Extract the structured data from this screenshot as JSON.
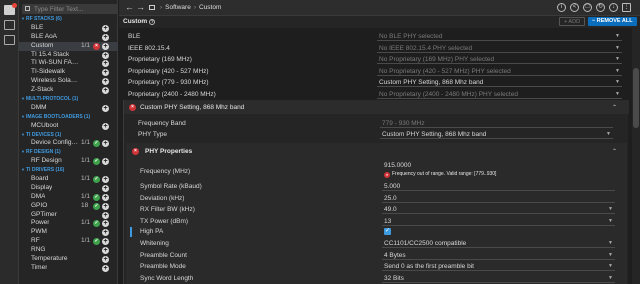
{
  "sidebar": {
    "filter_placeholder": "Type Filter Text...",
    "tree": [
      {
        "type": "cat",
        "label": "RF STACKS (6)"
      },
      {
        "type": "item",
        "label": "BLE",
        "count": "",
        "status": ""
      },
      {
        "type": "item",
        "label": "BLE AoA",
        "count": "",
        "status": ""
      },
      {
        "type": "item",
        "label": "Custom",
        "count": "1/1",
        "status": "err",
        "selected": true
      },
      {
        "type": "item",
        "label": "TI 15.4 Stack",
        "count": "",
        "status": ""
      },
      {
        "type": "item",
        "label": "TI Wi-SUN FAN Stack",
        "count": "",
        "status": ""
      },
      {
        "type": "item",
        "label": "TI-Sidewalk",
        "count": "",
        "status": ""
      },
      {
        "type": "item",
        "label": "Wireless Solar Managem...",
        "count": "",
        "status": ""
      },
      {
        "type": "item",
        "label": "Z-Stack",
        "count": "",
        "status": ""
      },
      {
        "type": "cat",
        "label": "MULTI-PROTOCOL (1)"
      },
      {
        "type": "item",
        "label": "DMM",
        "count": "",
        "status": ""
      },
      {
        "type": "cat",
        "label": "IMAGE BOOTLOADERS (1)"
      },
      {
        "type": "item",
        "label": "MCUboot",
        "count": "",
        "status": ""
      },
      {
        "type": "cat",
        "label": "TI DEVICES (1)"
      },
      {
        "type": "item",
        "label": "Device Configur...",
        "count": "1/1",
        "status": "ok"
      },
      {
        "type": "cat",
        "label": "RF DESIGN (1)"
      },
      {
        "type": "item",
        "label": "RF Design",
        "count": "1/1",
        "status": "ok"
      },
      {
        "type": "cat",
        "label": "TI DRIVERS (16)"
      },
      {
        "type": "item",
        "label": "Board",
        "count": "1/1",
        "status": "ok"
      },
      {
        "type": "item",
        "label": "Display",
        "count": "",
        "status": ""
      },
      {
        "type": "item",
        "label": "DMA",
        "count": "1/1",
        "status": "ok"
      },
      {
        "type": "item",
        "label": "GPIO",
        "count": "18",
        "status": "ok"
      },
      {
        "type": "item",
        "label": "GPTimer",
        "count": "",
        "status": ""
      },
      {
        "type": "item",
        "label": "Power",
        "count": "1/1",
        "status": "ok"
      },
      {
        "type": "item",
        "label": "PWM",
        "count": "",
        "status": ""
      },
      {
        "type": "item",
        "label": "RF",
        "count": "1/1",
        "status": "ok"
      },
      {
        "type": "item",
        "label": "RNG",
        "count": "",
        "status": ""
      },
      {
        "type": "item",
        "label": "Temperature",
        "count": "",
        "status": ""
      },
      {
        "type": "item",
        "label": "Timer",
        "count": "",
        "status": ""
      }
    ]
  },
  "topbar": {
    "back": "←",
    "forward": "→",
    "crumb1": "Software",
    "crumb2": "Custom",
    "sep": "›"
  },
  "header": {
    "title": "Custom",
    "add_label": "+ ADD",
    "remove_label": "− REMOVE ALL"
  },
  "phy_list": [
    {
      "label": "BLE",
      "value": "No BLE PHY selected",
      "disabled": true
    },
    {
      "label": "IEEE 802.15.4",
      "value": "No IEEE 802.15.4 PHY selected",
      "disabled": true
    },
    {
      "label": "Proprietary (169 MHz)",
      "value": "No Proprietary (169 MHz) PHY selected",
      "disabled": true
    },
    {
      "label": "Proprietary (420 - 527 MHz)",
      "value": "No Proprietary (420 - 527 MHz) PHY selected",
      "disabled": true
    },
    {
      "label": "Proprietary (779 - 930 MHz)",
      "value": "Custom PHY Setting, 868 Mhz band",
      "disabled": false
    },
    {
      "label": "Proprietary (2400 - 2480 MHz)",
      "value": "No Proprietary (2400 - 2480 MHz) PHY selected",
      "disabled": true
    }
  ],
  "panel": {
    "title": "Custom PHY Setting, 868 Mhz band",
    "frequency_band_label": "Frequency Band",
    "frequency_band_value": "779 - 930 MHz",
    "phy_type_label": "PHY Type",
    "phy_type_value": "Custom PHY Setting, 868 Mhz band"
  },
  "phy_properties": {
    "title": "PHY Properties",
    "frequency_label": "Frequency (MHz)",
    "frequency_value": "915.0000",
    "frequency_error": "Frequency out of range. Valid range: [779..930]",
    "rows": [
      {
        "label": "Symbol Rate (kBaud)",
        "value": "5.000",
        "dropdown": false
      },
      {
        "label": "Deviation (kHz)",
        "value": "25.0",
        "dropdown": false
      },
      {
        "label": "RX Filter BW (kHz)",
        "value": "49.0",
        "dropdown": true
      },
      {
        "label": "TX Power (dBm)",
        "value": "13",
        "dropdown": true
      }
    ],
    "high_pa_label": "High PA",
    "high_pa_checked": true,
    "rows2": [
      {
        "label": "Whitening",
        "value": "CC1101/CC2500 compatible",
        "dropdown": true
      },
      {
        "label": "Preamble Count",
        "value": "4 Bytes",
        "dropdown": true
      },
      {
        "label": "Preamble Mode",
        "value": "Send 0 as the first preamble bit",
        "dropdown": true
      },
      {
        "label": "Sync Word Length",
        "value": "32 Bits",
        "dropdown": true
      }
    ]
  }
}
